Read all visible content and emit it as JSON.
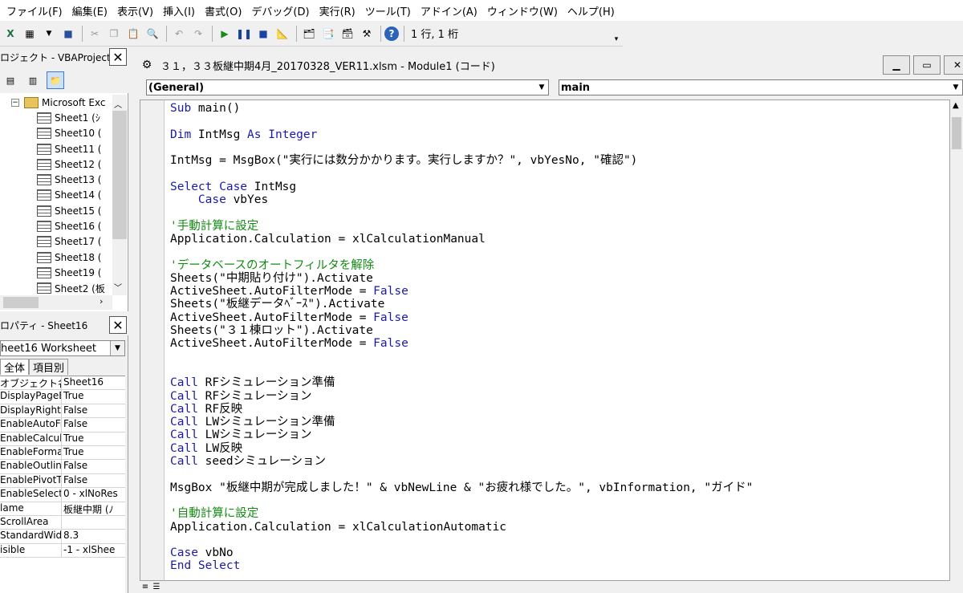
{
  "menu": [
    "ファイル(F)",
    "編集(E)",
    "表示(V)",
    "挿入(I)",
    "書式(O)",
    "デバッグ(D)",
    "実行(R)",
    "ツール(T)",
    "アドイン(A)",
    "ウィンドウ(W)",
    "ヘルプ(H)"
  ],
  "toolbar": {
    "position": "1 行, 1 桁"
  },
  "project_pane": {
    "title": "ロジェクト - VBAProject",
    "root": "Microsoft Exc",
    "sheets": [
      "Sheet1 (ｼ",
      "Sheet10 (",
      "Sheet11 (",
      "Sheet12 (",
      "Sheet13 (",
      "Sheet14 (",
      "Sheet15 (",
      "Sheet16 (",
      "Sheet17 (",
      "Sheet18 (",
      "Sheet19 (",
      "Sheet2 (板"
    ]
  },
  "properties_pane": {
    "title": "ロパティ - Sheet16",
    "object": "heet16 Worksheet",
    "tabs": [
      "全体",
      "項目別"
    ],
    "rows": [
      {
        "name": "オブジェクト名",
        "value": "Sheet16"
      },
      {
        "name": "DisplayPageB",
        "value": "True"
      },
      {
        "name": "DisplayRightT",
        "value": "False"
      },
      {
        "name": "EnableAutoFil",
        "value": "False"
      },
      {
        "name": "EnableCalcula",
        "value": "True"
      },
      {
        "name": "EnableFormat",
        "value": "True"
      },
      {
        "name": "EnableOutlinin",
        "value": "False"
      },
      {
        "name": "EnablePivotTa",
        "value": "False"
      },
      {
        "name": "EnableSelecti",
        "value": "0 - xlNoRes"
      },
      {
        "name": "lame",
        "value": "板継中期 (ﾉ"
      },
      {
        "name": "ScrollArea",
        "value": ""
      },
      {
        "name": "StandardWidth",
        "value": "8.3"
      },
      {
        "name": "isible",
        "value": "-1 - xlShee"
      }
    ]
  },
  "code_window": {
    "title": "３１，３３板継中期4月_20170328_VER11.xlsm - Module1 (コード)",
    "object_combo": "(General)",
    "proc_combo": "main"
  },
  "code": [
    [
      {
        "t": "Sub",
        "k": "kw"
      },
      {
        "t": " main()"
      }
    ],
    [],
    [
      {
        "t": "Dim",
        "k": "kw"
      },
      {
        "t": " IntMsg "
      },
      {
        "t": "As Integer",
        "k": "kw"
      }
    ],
    [],
    [
      {
        "t": "IntMsg = MsgBox(\"実行には数分かかります。実行しますか？\", vbYesNo, \"確認\")"
      }
    ],
    [],
    [
      {
        "t": "Select Case",
        "k": "kw"
      },
      {
        "t": " IntMsg"
      }
    ],
    [
      {
        "t": "    "
      },
      {
        "t": "Case",
        "k": "kw"
      },
      {
        "t": " vbYes"
      }
    ],
    [],
    [
      {
        "t": "'手動計算に設定",
        "k": "cm"
      }
    ],
    [
      {
        "t": "Application.Calculation = xlCalculationManual"
      }
    ],
    [],
    [
      {
        "t": "'データベースのオートフィルタを解除",
        "k": "cm"
      }
    ],
    [
      {
        "t": "Sheets(\"中期貼り付け\").Activate"
      }
    ],
    [
      {
        "t": "ActiveSheet.AutoFilterMode = "
      },
      {
        "t": "False",
        "k": "kw"
      }
    ],
    [
      {
        "t": "Sheets(\"板継データﾍﾞｰｽ\").Activate"
      }
    ],
    [
      {
        "t": "ActiveSheet.AutoFilterMode = "
      },
      {
        "t": "False",
        "k": "kw"
      }
    ],
    [
      {
        "t": "Sheets(\"３１棟ロット\").Activate"
      }
    ],
    [
      {
        "t": "ActiveSheet.AutoFilterMode = "
      },
      {
        "t": "False",
        "k": "kw"
      }
    ],
    [],
    [],
    [
      {
        "t": "Call",
        "k": "kw"
      },
      {
        "t": " RFシミュレーション準備"
      }
    ],
    [
      {
        "t": "Call",
        "k": "kw"
      },
      {
        "t": " RFシミュレーション"
      }
    ],
    [
      {
        "t": "Call",
        "k": "kw"
      },
      {
        "t": " RF反映"
      }
    ],
    [
      {
        "t": "Call",
        "k": "kw"
      },
      {
        "t": " LWシミュレーション準備"
      }
    ],
    [
      {
        "t": "Call",
        "k": "kw"
      },
      {
        "t": " LWシミュレーション"
      }
    ],
    [
      {
        "t": "Call",
        "k": "kw"
      },
      {
        "t": " LW反映"
      }
    ],
    [
      {
        "t": "Call",
        "k": "kw"
      },
      {
        "t": " seedシミュレーション"
      }
    ],
    [],
    [
      {
        "t": "MsgBox \"板継中期が完成しました！\" & vbNewLine & \"お疲れ様でした。\", vbInformation, \"ガイド\""
      }
    ],
    [],
    [
      {
        "t": "'自動計算に設定",
        "k": "cm"
      }
    ],
    [
      {
        "t": "Application.Calculation = xlCalculationAutomatic"
      }
    ],
    [],
    [
      {
        "t": "Case",
        "k": "kw"
      },
      {
        "t": " vbNo"
      }
    ],
    [
      {
        "t": "End Select",
        "k": "kw"
      }
    ]
  ]
}
